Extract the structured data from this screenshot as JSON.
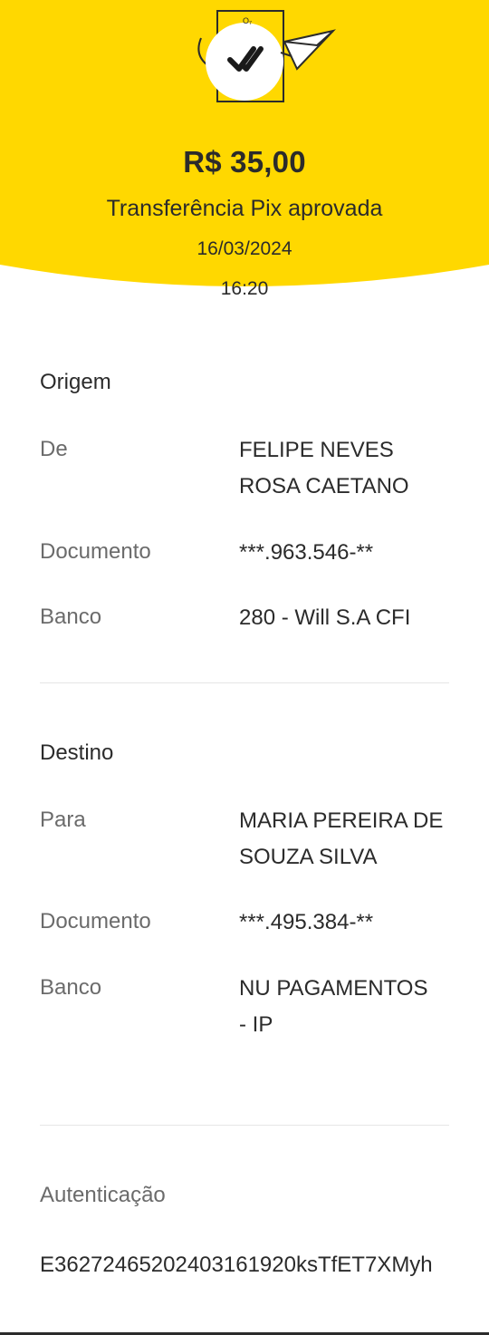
{
  "header": {
    "amount": "R$ 35,00",
    "status": "Transferência Pix aprovada",
    "date": "16/03/2024",
    "time": "16:20",
    "colors": {
      "yellow": "#FFD800",
      "text": "#2b2b2b"
    },
    "illustration_icon": "double-check-receipt-paper-plane"
  },
  "origem": {
    "title": "Origem",
    "de_label": "De",
    "de_value": "FELIPE NEVES ROSA CAETANO",
    "documento_label": "Documento",
    "documento_value": "***.963.546-**",
    "banco_label": "Banco",
    "banco_value": "280 - Will S.A CFI"
  },
  "destino": {
    "title": "Destino",
    "para_label": "Para",
    "para_value": "MARIA PEREIRA DE SOUZA SILVA",
    "documento_label": "Documento",
    "documento_value": "***.495.384-**",
    "banco_label": "Banco",
    "banco_value": "NU PAGAMENTOS - IP"
  },
  "autenticacao": {
    "label": "Autenticação",
    "code": "E3627246520240316192​0ksTfET7XMyh"
  }
}
